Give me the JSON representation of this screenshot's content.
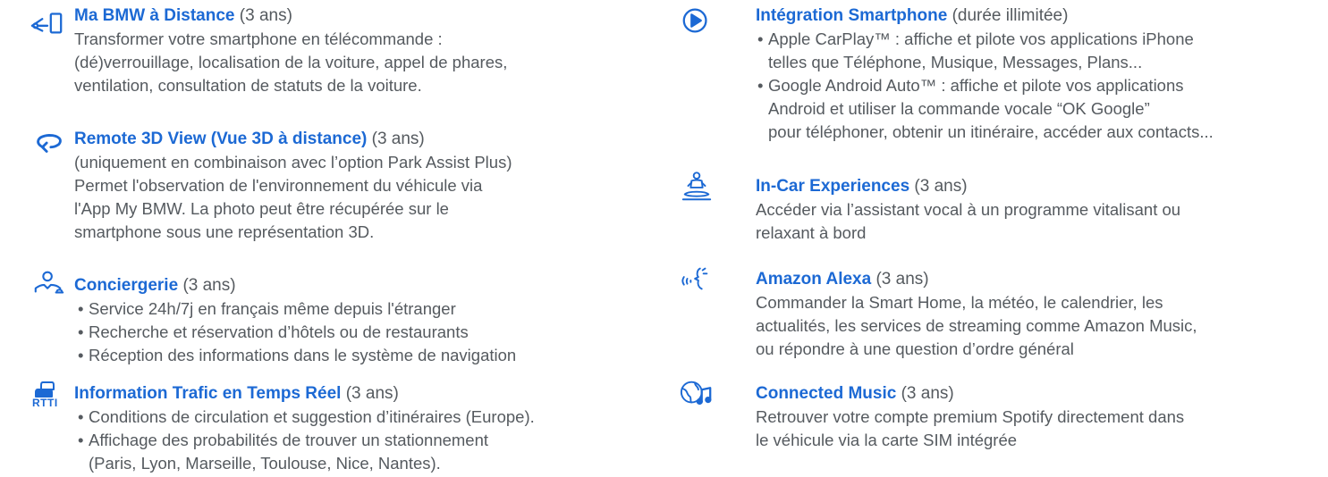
{
  "left": [
    {
      "title": "Ma BMW à Distance",
      "note": "(3 ans)",
      "icon": "car-key-phone-icon",
      "lines": [
        {
          "type": "text",
          "text": "Transformer votre smartphone en télécommande :"
        },
        {
          "type": "text",
          "text": "(dé)verrouillage, localisation de la voiture, appel de phares,"
        },
        {
          "type": "text",
          "text": "ventilation, consultation de statuts de la voiture."
        }
      ]
    },
    {
      "title": "Remote 3D View (Vue 3D à distance)",
      "note": "(3 ans)",
      "icon": "rotate-360-icon",
      "lines": [
        {
          "type": "text",
          "text": "(uniquement en combinaison avec l’option Park Assist Plus)"
        },
        {
          "type": "text",
          "text": "Permet l'observation de l'environnement du véhicule via"
        },
        {
          "type": "text",
          "text": "l'App My BMW. La photo peut être récupérée sur le"
        },
        {
          "type": "text",
          "text": "smartphone sous une représentation 3D."
        }
      ]
    },
    {
      "title": "Conciergerie",
      "note": "(3 ans)",
      "icon": "concierge-person-icon",
      "lines": [
        {
          "type": "bullet",
          "text": "Service 24h/7j en français même depuis l'étranger"
        },
        {
          "type": "bullet",
          "text": "Recherche et réservation d’hôtels ou de restaurants"
        },
        {
          "type": "bullet",
          "text": "Réception des informations dans le système de navigation"
        }
      ]
    },
    {
      "title": "Information Trafic en Temps Réel",
      "note": "(3 ans)",
      "icon": "rtti-traffic-icon",
      "icon_text": "RTTI",
      "lines": [
        {
          "type": "bullet",
          "text": "Conditions de circulation et suggestion d’itinéraires (Europe)."
        },
        {
          "type": "bullet",
          "text": "Affichage des probabilités de trouver un stationnement"
        },
        {
          "type": "cont",
          "text": "(Paris, Lyon, Marseille, Toulouse, Nice, Nantes)."
        }
      ]
    }
  ],
  "right": [
    {
      "title": "Intégration Smartphone",
      "note": "(durée illimitée)",
      "icon": "play-circle-icon",
      "lines": [
        {
          "type": "bullet",
          "text": "Apple CarPlay™ : affiche et pilote vos applications iPhone"
        },
        {
          "type": "cont",
          "text": "telles que Téléphone, Musique, Messages, Plans..."
        },
        {
          "type": "bullet",
          "text": "Google Android Auto™ : affiche et pilote vos applications"
        },
        {
          "type": "cont",
          "text": "Android et utiliser la commande vocale “OK Google”"
        },
        {
          "type": "cont",
          "text": "pour téléphoner, obtenir un itinéraire, accéder aux contacts..."
        }
      ]
    },
    {
      "title": "In-Car Experiences",
      "note": "(3 ans)",
      "icon": "meditation-icon",
      "lines": [
        {
          "type": "text",
          "text": "Accéder via l’assistant vocal à un programme vitalisant ou"
        },
        {
          "type": "text",
          "text": "relaxant à bord"
        }
      ]
    },
    {
      "title": "Amazon Alexa",
      "note": "(3 ans)",
      "icon": "voice-assistant-icon",
      "lines": [
        {
          "type": "text",
          "text": "Commander la Smart Home, la météo, le calendrier, les"
        },
        {
          "type": "text",
          "text": "actualités, les services de streaming comme Amazon Music,"
        },
        {
          "type": "text",
          "text": "ou répondre à une question d’ordre général"
        }
      ]
    },
    {
      "title": "Connected Music",
      "note": "(3 ans)",
      "icon": "globe-music-icon",
      "lines": [
        {
          "type": "text",
          "text": "Retrouver votre compte premium Spotify directement dans"
        },
        {
          "type": "text",
          "text": "le véhicule via la carte SIM intégrée"
        }
      ]
    }
  ],
  "colors": {
    "accent": "#1c69d4",
    "text": "#555a5f"
  }
}
